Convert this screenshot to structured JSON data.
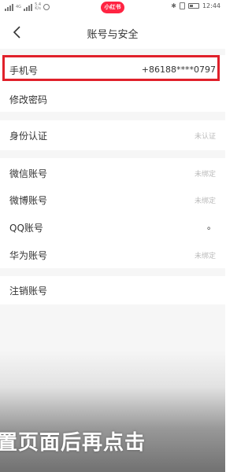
{
  "status_bar": {
    "network_label": "4G",
    "speed_value": "5.4",
    "speed_unit": "K/s",
    "app_badge": "小红书",
    "bluetooth": "✱",
    "time": "12:44",
    "battery_level": 0.35
  },
  "nav": {
    "title": "账号与安全"
  },
  "rows": {
    "phone": {
      "label": "手机号",
      "value": "+86188****0797"
    },
    "password": {
      "label": "修改密码"
    },
    "identity": {
      "label": "身份认证",
      "value": "未认证"
    },
    "wechat": {
      "label": "微信账号",
      "value": "未绑定"
    },
    "weibo": {
      "label": "微博账号",
      "value": "未绑定"
    },
    "qq": {
      "label": "QQ账号",
      "value": "。"
    },
    "huawei": {
      "label": "华为账号",
      "value": "未绑定"
    },
    "cancel": {
      "label": "注销账号"
    }
  },
  "caption": "置页面后再点击",
  "colors": {
    "highlight": "#e0202a",
    "badge": "#ff2442",
    "section_gap": "#f6f6f6"
  }
}
